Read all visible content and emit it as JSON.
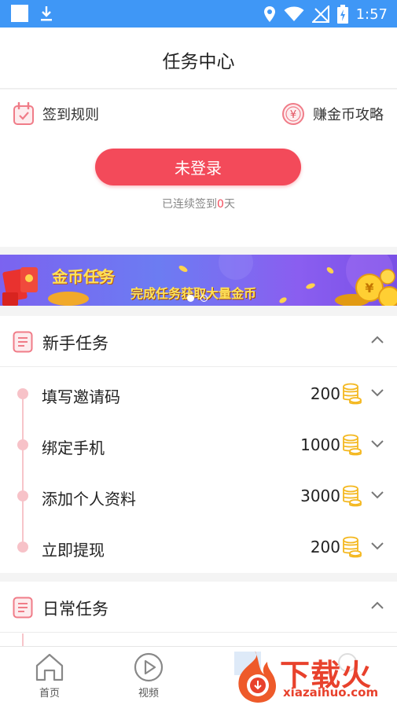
{
  "status_bar": {
    "time": "1:57"
  },
  "header": {
    "title": "任务中心"
  },
  "sign": {
    "rule_label": "签到规则",
    "coin_guide_label": "赚金币攻略",
    "login_button": "未登录",
    "streak_prefix": "已连续签到",
    "streak_days": "0",
    "streak_suffix": "天"
  },
  "banner": {
    "title": "金币任务",
    "subtitle": "完成任务获取大量金币",
    "slide_count": 2,
    "active_slide": 1
  },
  "newbie": {
    "title": "新手任务",
    "tasks": [
      {
        "name": "填写邀请码",
        "coins": "200"
      },
      {
        "name": "绑定手机",
        "coins": "1000"
      },
      {
        "name": "添加个人资料",
        "coins": "3000"
      },
      {
        "name": "立即提现",
        "coins": "200"
      }
    ]
  },
  "daily": {
    "title": "日常任务"
  },
  "bottom_nav": {
    "items": [
      {
        "label": "首页"
      },
      {
        "label": "视频"
      }
    ]
  },
  "watermark": {
    "text": "下载火",
    "url": "xiazaihuo.com"
  },
  "colors": {
    "status_bar": "#3f97f6",
    "accent": "#f34a5a",
    "coin": "#f4b820",
    "timeline": "#f7c2c8"
  }
}
